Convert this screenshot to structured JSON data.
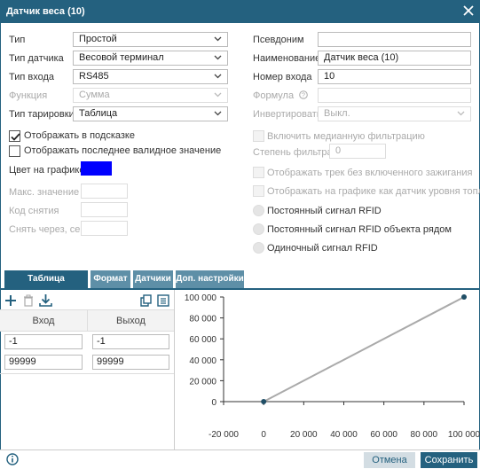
{
  "window": {
    "title": "Датчик веса (10)"
  },
  "left_form": {
    "type": {
      "label": "Тип",
      "value": "Простой"
    },
    "sensor_type": {
      "label": "Тип датчика",
      "value": "Весовой терминал"
    },
    "input_type": {
      "label": "Тип входа",
      "value": "RS485"
    },
    "function": {
      "label": "Функция",
      "value": "Сумма"
    },
    "calibration_type": {
      "label": "Тип тарировки",
      "value": "Таблица"
    },
    "show_in_tooltip": {
      "label": "Отображать в подсказке",
      "checked": true
    },
    "show_last_valid": {
      "label": "Отображать последнее валидное значение",
      "checked": false
    },
    "graph_color": {
      "label": "Цвет на графике",
      "color": "#0000ff"
    },
    "max_value": {
      "label": "Макс. значение",
      "value": ""
    },
    "snapshot_code": {
      "label": "Код снятия",
      "value": ""
    },
    "snapshot_after": {
      "label": "Снять через, сек",
      "value": ""
    }
  },
  "right_form": {
    "alias": {
      "label": "Псевдоним",
      "value": ""
    },
    "name": {
      "label": "Наименование",
      "value": "Датчик веса (10)"
    },
    "input_number": {
      "label": "Номер входа",
      "value": "10"
    },
    "formula": {
      "label": "Формула",
      "value": ""
    },
    "invert": {
      "label": "Инвертировать",
      "value": "Выкл."
    },
    "median_filter": {
      "label": "Включить медианную фильтрацию"
    },
    "filter_degree": {
      "label": "Степень фильтрации",
      "value": "0"
    },
    "track_without_ignition": {
      "label": "Отображать трек без включенного зажигания"
    },
    "fuel_level_graph": {
      "label": "Отображать на графике как датчик уровня топлива"
    },
    "rfid_constant": {
      "label": "Постоянный сигнал RFID"
    },
    "rfid_constant_near": {
      "label": "Постоянный сигнал RFID объекта рядом"
    },
    "rfid_single": {
      "label": "Одиночный сигнал RFID"
    }
  },
  "tabs": [
    "Таблица тарировки",
    "Формат",
    "Датчики",
    "Доп. настройки"
  ],
  "toolbar": {
    "icons": [
      "add-icon",
      "delete-icon",
      "download-icon",
      "copy-icon",
      "list-icon"
    ]
  },
  "calibration_table": {
    "headers": [
      "Вход",
      "Выход"
    ],
    "rows": [
      [
        "-1",
        "-1"
      ],
      [
        "99999",
        "99999"
      ]
    ]
  },
  "chart_data": {
    "type": "line",
    "x": [
      -1,
      99999
    ],
    "y": [
      -1,
      99999
    ],
    "xlim": [
      -20000,
      100000
    ],
    "ylim": [
      0,
      100000
    ],
    "x_ticks": [
      "-20 000",
      "0",
      "20 000",
      "40 000",
      "60 000",
      "80 000",
      "100 000"
    ],
    "y_ticks": [
      "0",
      "20 000",
      "40 000",
      "60 000",
      "80 000",
      "100 000"
    ],
    "line_color": "#aaaaaa",
    "point_color": "#1f4e66",
    "grid": false
  },
  "footer": {
    "info_icon": "info-icon",
    "cancel": "Отмена",
    "save": "Сохранить"
  },
  "colors": {
    "accent": "#24617f",
    "tab_inactive": "#5e8fa7"
  }
}
